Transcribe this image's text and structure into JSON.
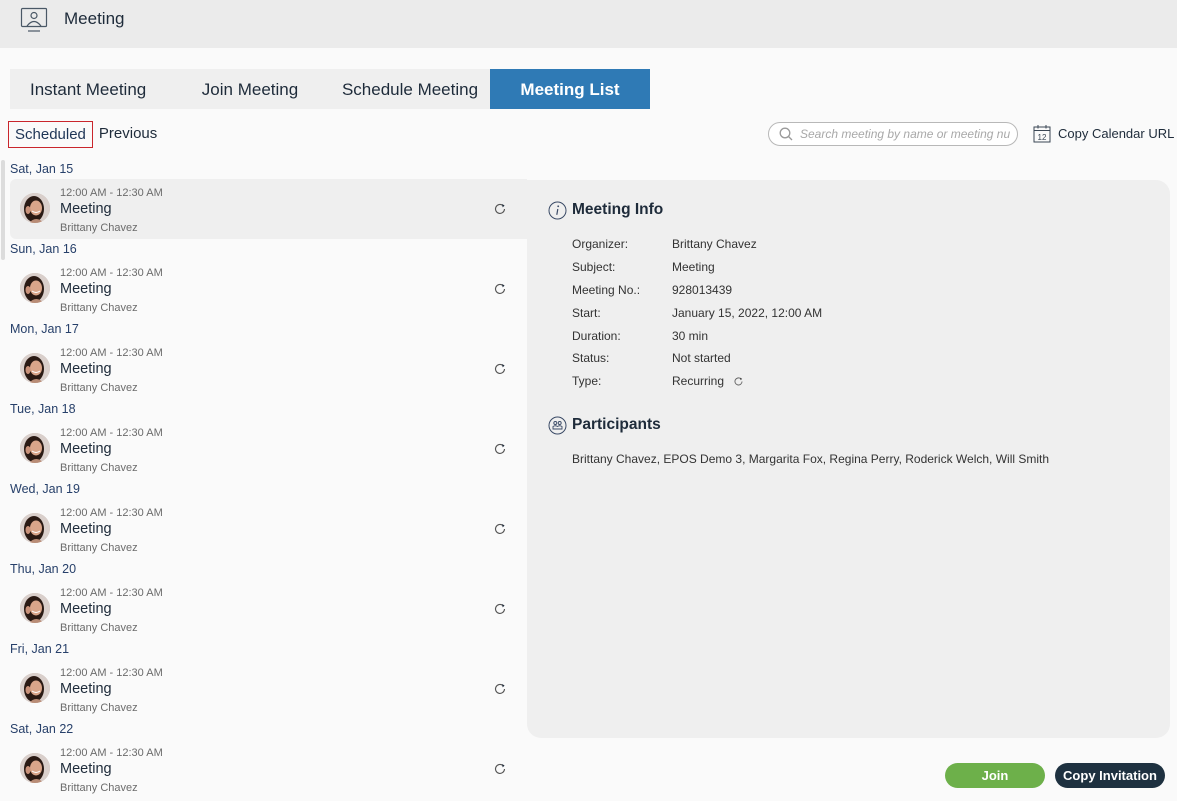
{
  "app": {
    "title": "Meeting",
    "icon": "presenter-screen-icon"
  },
  "tabs": [
    {
      "label": "Instant Meeting",
      "active": false
    },
    {
      "label": "Join Meeting",
      "active": false
    },
    {
      "label": "Schedule Meeting",
      "active": false
    },
    {
      "label": "Meeting List",
      "active": true
    }
  ],
  "subtabs": [
    {
      "label": "Scheduled",
      "active": true
    },
    {
      "label": "Previous",
      "active": false
    }
  ],
  "search": {
    "placeholder": "Search meeting by name or meeting number",
    "value": ""
  },
  "copy_calendar": {
    "label": "Copy Calendar URL",
    "icon": "calendar-icon",
    "icon_text": "12"
  },
  "meetings": [
    {
      "date": "Sat, Jan 15",
      "time": "12:00 AM - 12:30 AM",
      "title": "Meeting",
      "organizer": "Brittany Chavez",
      "recurring": true,
      "selected": true
    },
    {
      "date": "Sun, Jan 16",
      "time": "12:00 AM - 12:30 AM",
      "title": "Meeting",
      "organizer": "Brittany Chavez",
      "recurring": true,
      "selected": false
    },
    {
      "date": "Mon, Jan 17",
      "time": "12:00 AM - 12:30 AM",
      "title": "Meeting",
      "organizer": "Brittany Chavez",
      "recurring": true,
      "selected": false
    },
    {
      "date": "Tue, Jan 18",
      "time": "12:00 AM - 12:30 AM",
      "title": "Meeting",
      "organizer": "Brittany Chavez",
      "recurring": true,
      "selected": false
    },
    {
      "date": "Wed, Jan 19",
      "time": "12:00 AM - 12:30 AM",
      "title": "Meeting",
      "organizer": "Brittany Chavez",
      "recurring": true,
      "selected": false
    },
    {
      "date": "Thu, Jan 20",
      "time": "12:00 AM - 12:30 AM",
      "title": "Meeting",
      "organizer": "Brittany Chavez",
      "recurring": true,
      "selected": false
    },
    {
      "date": "Fri, Jan 21",
      "time": "12:00 AM - 12:30 AM",
      "title": "Meeting",
      "organizer": "Brittany Chavez",
      "recurring": true,
      "selected": false
    },
    {
      "date": "Sat, Jan 22",
      "time": "12:00 AM - 12:30 AM",
      "title": "Meeting",
      "organizer": "Brittany Chavez",
      "recurring": true,
      "selected": false
    }
  ],
  "meeting_info": {
    "title": "Meeting Info",
    "rows": [
      {
        "key": "Organizer:",
        "value": "Brittany Chavez"
      },
      {
        "key": "Subject:",
        "value": "Meeting"
      },
      {
        "key": "Meeting No.:",
        "value": "928013439"
      },
      {
        "key": "Start:",
        "value": "January 15, 2022, 12:00 AM"
      },
      {
        "key": "Duration:",
        "value": "30 min"
      },
      {
        "key": "Status:",
        "value": "Not started"
      },
      {
        "key": "Type:",
        "value": "Recurring"
      }
    ]
  },
  "participants": {
    "title": "Participants",
    "list": "Brittany Chavez, EPOS Demo 3, Margarita Fox, Regina Perry, Roderick Welch, Will Smith"
  },
  "actions": {
    "join": "Join",
    "copy_invitation": "Copy Invitation"
  },
  "colors": {
    "accent": "#2f7ab5",
    "join": "#6db04a",
    "dark_button": "#1e3140",
    "selected_border": "#c9252c"
  }
}
